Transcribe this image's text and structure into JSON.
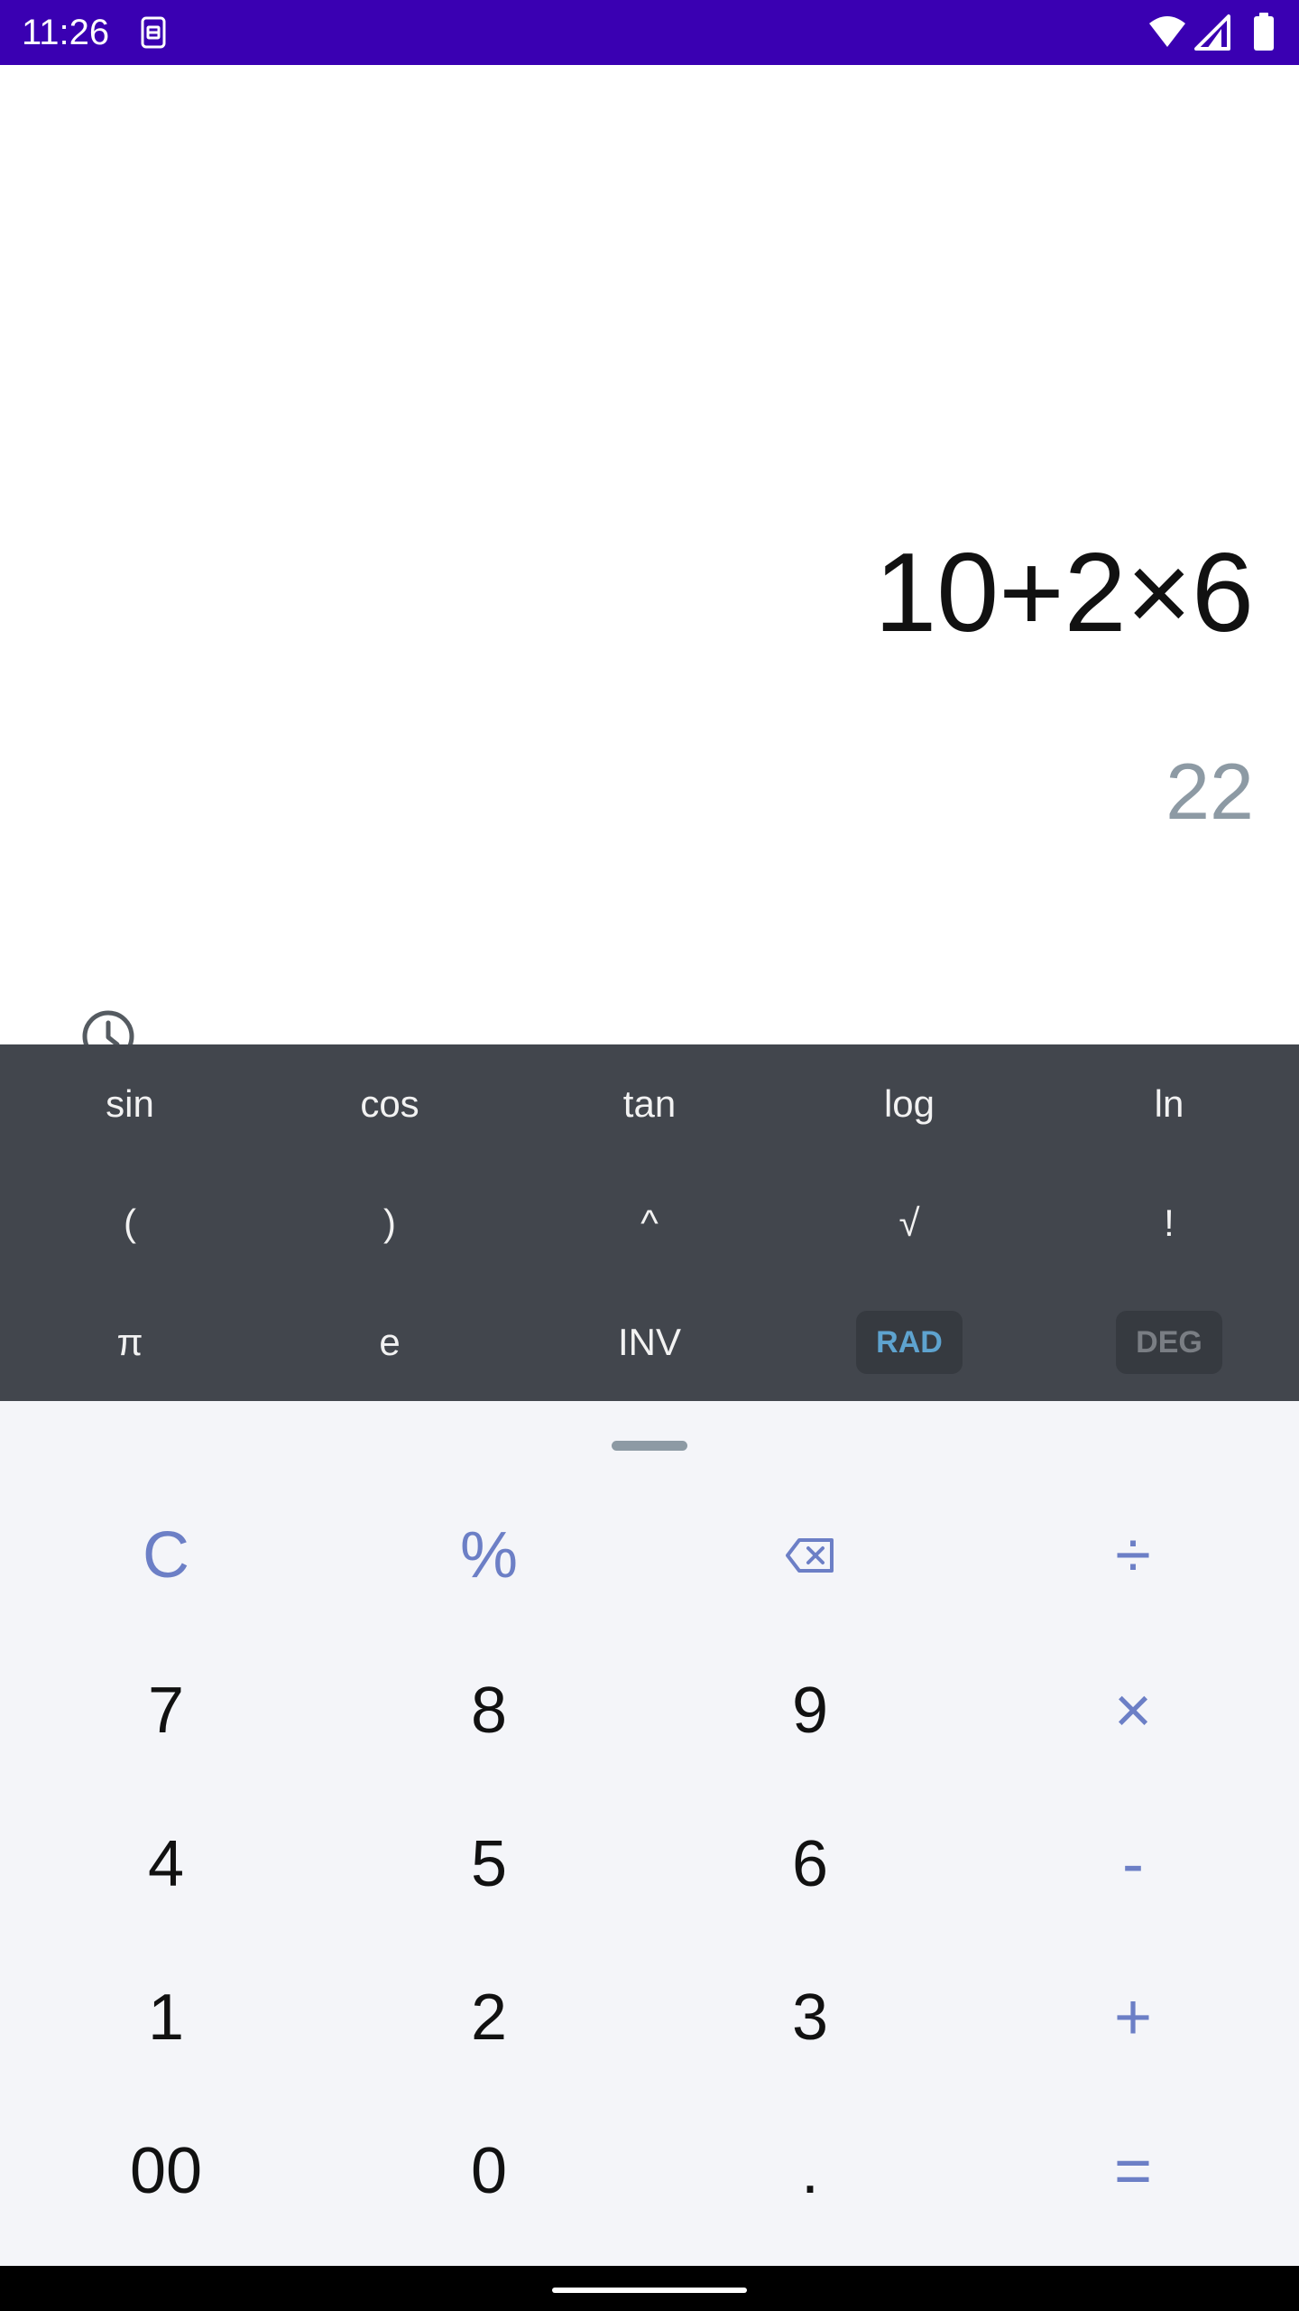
{
  "status_bar": {
    "time": "11:26",
    "icons": [
      "sim-icon",
      "wifi-icon",
      "cellular-signal-icon",
      "battery-icon"
    ],
    "bg_color": "#3a00b2"
  },
  "display": {
    "expression": "10+2×6",
    "result": "22",
    "history_icon": "history-clock-icon"
  },
  "scientific": {
    "row1": [
      "sin",
      "cos",
      "tan",
      "log",
      "ln"
    ],
    "row2": [
      "(",
      ")",
      "^",
      "√",
      "!"
    ],
    "row3": [
      "π",
      "e",
      "INV",
      "RAD",
      "DEG"
    ],
    "active_angle_mode": "RAD",
    "bg_color": "#42464d"
  },
  "keypad": {
    "row1": [
      "C",
      "%",
      "backspace",
      "÷"
    ],
    "row2": [
      "7",
      "8",
      "9",
      "×"
    ],
    "row3": [
      "4",
      "5",
      "6",
      "-"
    ],
    "row4": [
      "1",
      "2",
      "3",
      "+"
    ],
    "row5": [
      "00",
      "0",
      ".",
      "="
    ],
    "accent_color": "#6c7fc6",
    "bg_color": "#f4f5f9"
  }
}
